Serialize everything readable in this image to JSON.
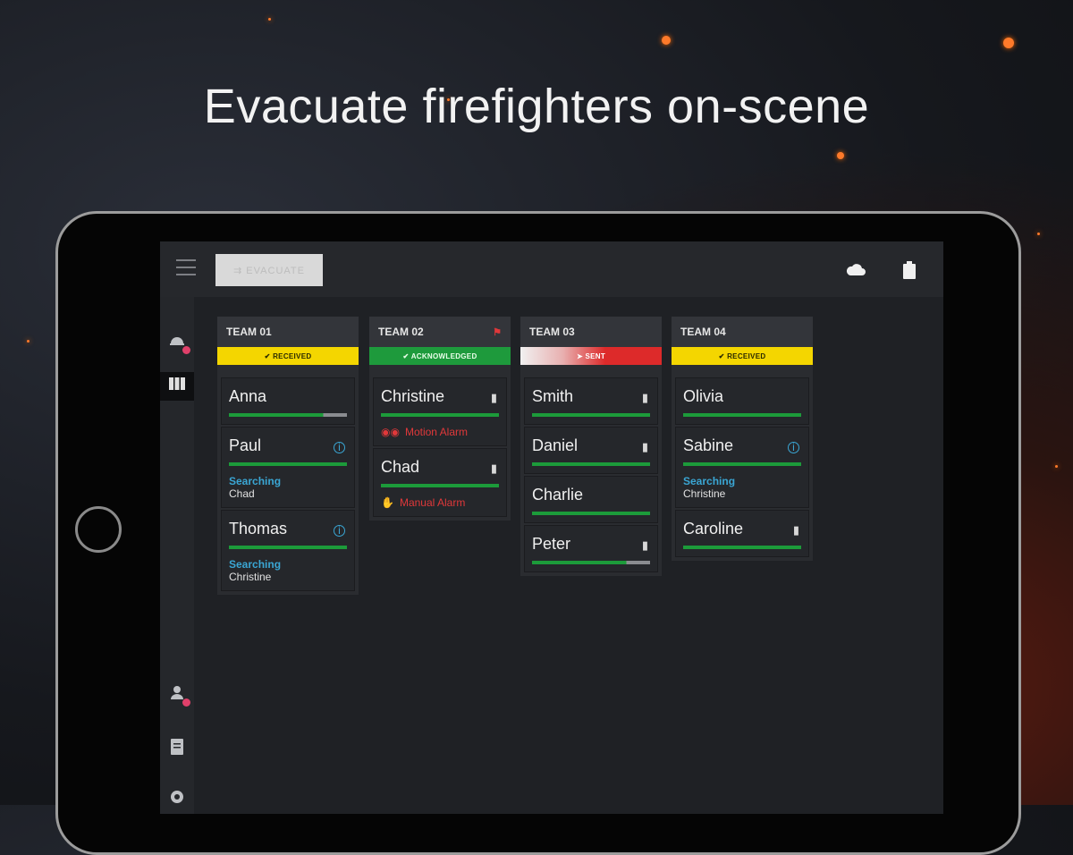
{
  "headline": "Evacuate firefighters on-scene",
  "topbar": {
    "evacuate_label": "⇉ EVACUATE",
    "icons": [
      "menu-icon",
      "cloud-icon",
      "battery-icon"
    ]
  },
  "sidebar": {
    "icons": [
      "helmet-icon",
      "columns-icon",
      "person-icon",
      "document-icon",
      "gear-icon"
    ]
  },
  "colors": {
    "received": "#f4d600",
    "acknowledged": "#1e9a3c",
    "sent": "#dd2a2a",
    "searching": "#3aa6d4",
    "alarm": "#e0383a"
  },
  "teams": [
    {
      "name": "TEAM 01",
      "status": "✔ RECEIVED",
      "members": [
        {
          "name": "Anna"
        },
        {
          "name": "Paul",
          "searching": "Searching",
          "searching_who": "Chad"
        },
        {
          "name": "Thomas",
          "searching": "Searching",
          "searching_who": "Christine"
        }
      ]
    },
    {
      "name": "TEAM 02",
      "status": "✔ ACKNOWLEDGED",
      "members": [
        {
          "name": "Christine",
          "alarm": "Motion Alarm"
        },
        {
          "name": "Chad",
          "alarm": "Manual Alarm"
        }
      ]
    },
    {
      "name": "TEAM 03",
      "status": "➤ SENT",
      "members": [
        {
          "name": "Smith"
        },
        {
          "name": "Daniel"
        },
        {
          "name": "Charlie"
        },
        {
          "name": "Peter"
        }
      ]
    },
    {
      "name": "TEAM 04",
      "status": "✔ RECEIVED",
      "members": [
        {
          "name": "Olivia"
        },
        {
          "name": "Sabine",
          "searching": "Searching",
          "searching_who": "Christine"
        },
        {
          "name": "Caroline"
        }
      ]
    }
  ]
}
